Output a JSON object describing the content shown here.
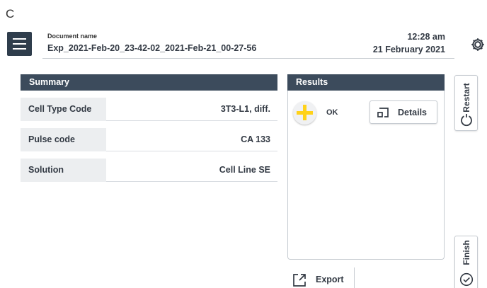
{
  "figure_label": "C",
  "header": {
    "doc_caption": "Document name",
    "doc_name": "Exp_2021-Feb-20_23-42-02_2021-Feb-21_00-27-56",
    "time": "12:28 am",
    "date": "21 February 2021",
    "icons": {
      "menu": "hamburger-menu-icon",
      "settings": "settings-gear-icon"
    }
  },
  "summary": {
    "title": "Summary",
    "rows": [
      {
        "label": "Cell Type Code",
        "value": "3T3-L1, diff."
      },
      {
        "label": "Pulse code",
        "value": "CA 133"
      },
      {
        "label": "Solution",
        "value": "Cell Line SE"
      }
    ]
  },
  "results": {
    "title": "Results",
    "status": "OK",
    "status_icon": "plus-icon",
    "status_color": "#ffd21a",
    "details_label": "Details",
    "details_icon": "details-icon"
  },
  "export": {
    "label": "Export",
    "icon": "export-icon"
  },
  "side": {
    "restart_label": "Restart",
    "restart_icon": "restart-icon",
    "finish_label": "Finish",
    "finish_icon": "check-circle-icon"
  },
  "colors": {
    "panel_header": "#3c4b5c",
    "menu_button": "#2f3d4c",
    "label_bg": "#eceef0"
  }
}
